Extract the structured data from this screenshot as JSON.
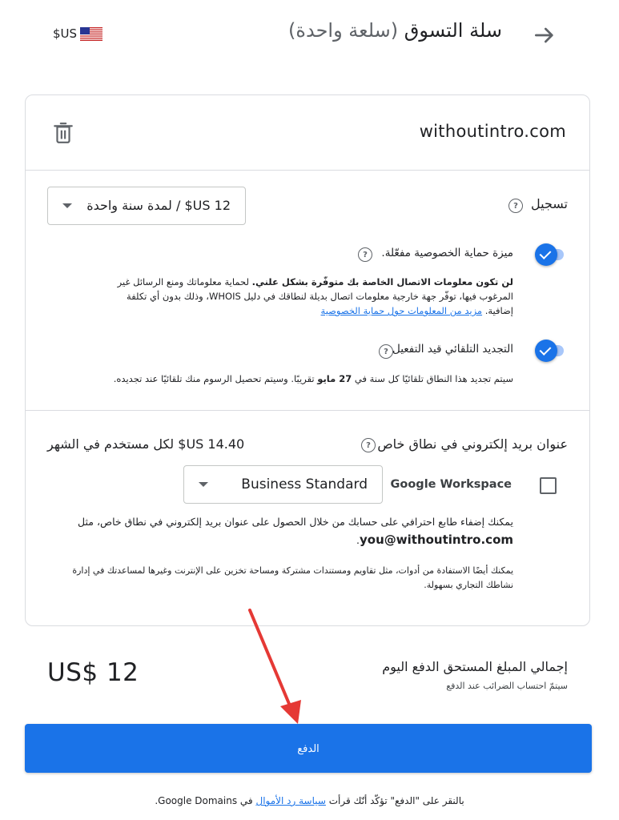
{
  "header": {
    "title": "سلة التسوق",
    "title_suffix": "(سلعة واحدة)",
    "currency": "$US"
  },
  "domain_item": {
    "domain": "withoutintro.com",
    "registration": {
      "label": "تسجيل",
      "help": "?",
      "selected_option": "12 US$ / لمدة سنة واحدة"
    },
    "privacy": {
      "title": "ميزة حماية الخصوصية مفعّلة.",
      "help": "?",
      "body_bold": "لن تكون معلومات الاتصال الخاصة بك متوفّرة بشكل علني.",
      "body_rest": " لحماية معلوماتك ومنع الرسائل غير المرغوب فيها، توفّر جهة خارجية معلومات اتصال بديلة لنطاقك في دليل WHOIS، وذلك بدون أي تكلفة إضافية. ",
      "link_text": "مزيد من المعلومات حول حماية الخصوصية",
      "enabled": true
    },
    "auto_renew": {
      "title": "التجديد التلقائي قيد التفعيل",
      "help": "?",
      "body_start": "سيتم تجديد هذا النطاق تلقائيًا كل سنة في ",
      "body_date": "27 مايو",
      "body_end": " تقريبًا. وسيتم تحصيل الرسوم منك تلقائيًا عند تجديده.",
      "enabled": true
    }
  },
  "email_section": {
    "title": "عنوان بريد إلكتروني في نطاق خاص",
    "help": "?",
    "price": "14.40 US$ لكل مستخدم في الشهر",
    "product": "Google Workspace",
    "checked": false,
    "plan": "Business Standard",
    "body1": "يمكنك إضفاء طابع احترافي على حسابك من خلال الحصول على عنوان بريد إلكتروني في نطاق خاص، مثل",
    "example_email": "you@withoutintro.com",
    "body1_end": ".",
    "body2": "يمكنك أيضًا الاستفادة من أدوات، مثل تقاويم ومستندات مشتركة ومساحة تخزين على الإنترنت وغيرها لمساعدتك في إدارة نشاطك التجاري بسهولة."
  },
  "total": {
    "label": "إجمالي المبلغ المستحق الدفع اليوم",
    "sub": "سيتمّ احتساب الضرائب عند الدفع",
    "amount": "US$ 12"
  },
  "pay_button": "الدفع",
  "footer": {
    "prefix": "بالنقر على \"الدفع\" تؤكّد أنّك قرأت ",
    "link": "سياسة رد الأموال",
    "suffix": " في Google Domains."
  },
  "colors": {
    "primary": "#1a73e8",
    "annotation_arrow": "#e53935"
  }
}
